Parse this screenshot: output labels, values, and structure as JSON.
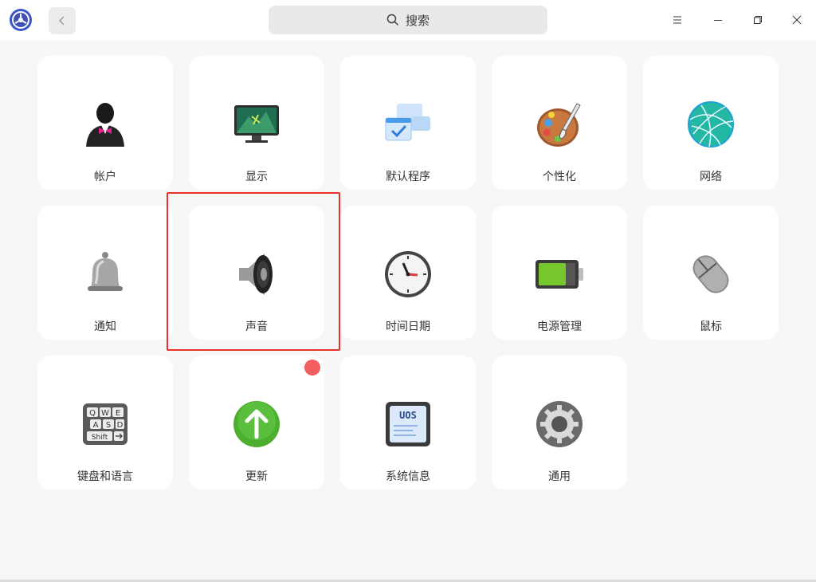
{
  "search": {
    "label": "搜索"
  },
  "modules": [
    {
      "label": "帐户",
      "icon": "account-icon"
    },
    {
      "label": "显示",
      "icon": "display-icon"
    },
    {
      "label": "默认程序",
      "icon": "default-apps-icon"
    },
    {
      "label": "个性化",
      "icon": "personalization-icon"
    },
    {
      "label": "网络",
      "icon": "network-icon"
    },
    {
      "label": "通知",
      "icon": "notification-bell-icon"
    },
    {
      "label": "声音",
      "icon": "speaker-icon"
    },
    {
      "label": "时间日期",
      "icon": "clock-icon"
    },
    {
      "label": "电源管理",
      "icon": "battery-icon"
    },
    {
      "label": "鼠标",
      "icon": "mouse-icon"
    },
    {
      "label": "键盘和语言",
      "icon": "keyboard-icon"
    },
    {
      "label": "更新",
      "icon": "update-arrow-icon"
    },
    {
      "label": "系统信息",
      "icon": "system-info-icon"
    },
    {
      "label": "通用",
      "icon": "gear-icon"
    }
  ],
  "system_info_icon_text": "UOS",
  "keyboard_keys": [
    "Q",
    "W",
    "E",
    "A",
    "S",
    "D",
    "Shift"
  ],
  "colors": {
    "highlight": "#e8322a",
    "badge": "#f25e5e",
    "update_green": "#4caf2f"
  }
}
